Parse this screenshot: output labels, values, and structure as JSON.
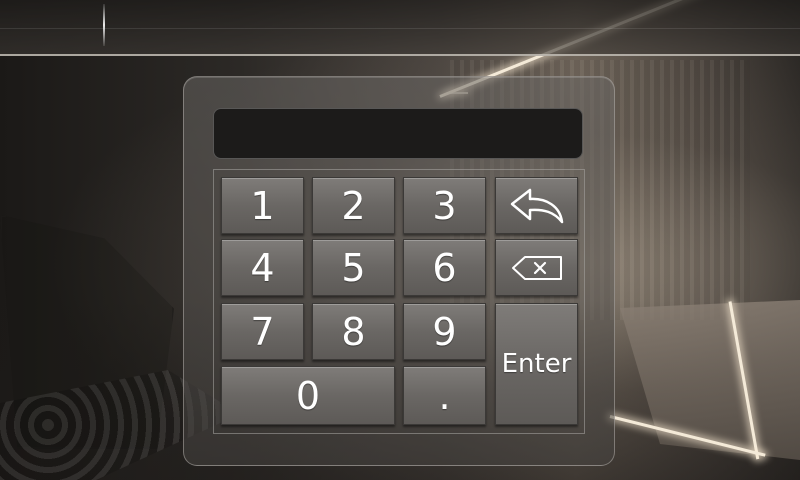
{
  "display": {
    "value": ""
  },
  "keys": {
    "k1": "1",
    "k2": "2",
    "k3": "3",
    "k4": "4",
    "k5": "5",
    "k6": "6",
    "k7": "7",
    "k8": "8",
    "k9": "9",
    "k0": "0",
    "dot": ".",
    "enter": "Enter"
  },
  "icons": {
    "back": "back-arrow-icon",
    "delete": "backspace-icon"
  },
  "colors": {
    "key_face": "#6a6764",
    "display_bg": "#1c1b1a",
    "light_strip": "#f4ead8"
  }
}
